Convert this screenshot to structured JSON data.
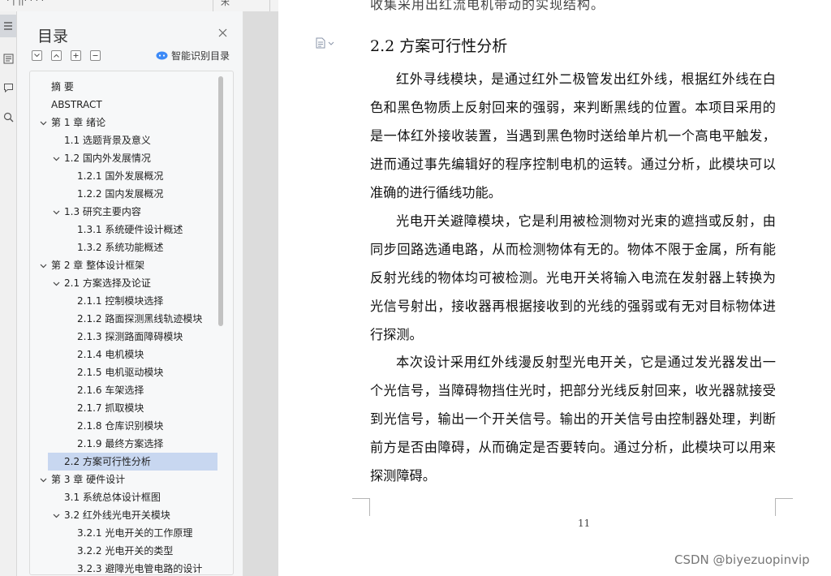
{
  "toolbar": {
    "partial_labels": [
      "·  |  ||· ·  ·  ·",
      "宋",
      "·  ·  ·  ·",
      "·",
      "·  ·  ·"
    ]
  },
  "rail": {
    "buttons": [
      {
        "name": "toc-icon"
      },
      {
        "name": "outline-icon"
      },
      {
        "name": "comment-icon"
      },
      {
        "name": "search-icon"
      }
    ]
  },
  "nav": {
    "title": "目录",
    "smart_toc_label": "智能识别目录",
    "items": [
      {
        "label": "摘    要",
        "level": 0,
        "caret": false
      },
      {
        "label": "ABSTRACT",
        "level": 0,
        "caret": false
      },
      {
        "label": "第 1 章  绪论",
        "level": 0,
        "caret": true
      },
      {
        "label": "1.1 选题背景及意义",
        "level": 1,
        "caret": false
      },
      {
        "label": "1.2  国内外发展情况",
        "level": 1,
        "caret": true
      },
      {
        "label": "1.2.1 国外发展概况",
        "level": 2,
        "caret": false
      },
      {
        "label": "1.2.2 国内发展概况",
        "level": 2,
        "caret": false
      },
      {
        "label": "1.3 研究主要内容",
        "level": 1,
        "caret": true
      },
      {
        "label": "1.3.1  系统硬件设计概述",
        "level": 2,
        "caret": false
      },
      {
        "label": "1.3.2  系统功能概述",
        "level": 2,
        "caret": false
      },
      {
        "label": "第 2 章  整体设计框架",
        "level": 0,
        "caret": true
      },
      {
        "label": "2.1  方案选择及论证",
        "level": 1,
        "caret": true
      },
      {
        "label": "2.1.1  控制模块选择",
        "level": 2,
        "caret": false
      },
      {
        "label": "2.1.2  路面探测黑线轨迹模块",
        "level": 2,
        "caret": false
      },
      {
        "label": "2.1.3  探测路面障碍模块",
        "level": 2,
        "caret": false
      },
      {
        "label": "2.1.4  电机模块",
        "level": 2,
        "caret": false
      },
      {
        "label": "2.1.5  电机驱动模块",
        "level": 2,
        "caret": false
      },
      {
        "label": "2.1.6  车架选择",
        "level": 2,
        "caret": false
      },
      {
        "label": "2.1.7  抓取模块",
        "level": 2,
        "caret": false
      },
      {
        "label": "2.1.8  仓库识别模块",
        "level": 2,
        "caret": false
      },
      {
        "label": "2.1.9  最终方案选择",
        "level": 2,
        "caret": false
      },
      {
        "label": "2.2  方案可行性分析",
        "level": 1,
        "caret": false,
        "selected": true
      },
      {
        "label": "第 3 章  硬件设计",
        "level": 0,
        "caret": true
      },
      {
        "label": "3.1  系统总体设计框图",
        "level": 1,
        "caret": false
      },
      {
        "label": "3.2  红外线光电开关模块",
        "level": 1,
        "caret": true
      },
      {
        "label": "3.2.1  光电开关的工作原理",
        "level": 2,
        "caret": false
      },
      {
        "label": "3.2.2  光电开关的类型",
        "level": 2,
        "caret": false
      },
      {
        "label": "3.2.3  避障光电管电路的设计",
        "level": 2,
        "caret": false
      }
    ]
  },
  "doc": {
    "top_partial_line": "收集采用出红流电机带动的实现结构。",
    "heading": "2.2  方案可行性分析",
    "paragraphs": [
      "红外寻线模块，是通过红外二极管发出红外线，根据红外线在白色和黑色物质上反射回来的强弱，来判断黑线的位置。本项目采用的是一体红外接收装置，当遇到黑色物时送给单片机一个高电平触发，进而通过事先编辑好的程序控制电机的运转。通过分析，此模块可以准确的进行循线功能。",
      "光电开关避障模块，它是利用被检测物对光束的遮挡或反射，由同步回路选通电路，从而检测物体有无的。物体不限于金属，所有能反射光线的物体均可被检测。光电开关将输入电流在发射器上转换为光信号射出，接收器再根据接收到的光线的强弱或有无对目标物体进行探测。",
      "本次设计采用红外线漫反射型光电开关，它是通过发光器发出一个光信号，当障碍物挡住光时，把部分光线反射回来，收光器就接受到光信号，输出一个开关信号。输出的开关信号由控制器处理，判断前方是否由障碍，从而确定是否要转向。通过分析，此模块可以用来探测障碍。"
    ],
    "page_number": "11"
  },
  "watermark": "CSDN @biyezuopinvip"
}
